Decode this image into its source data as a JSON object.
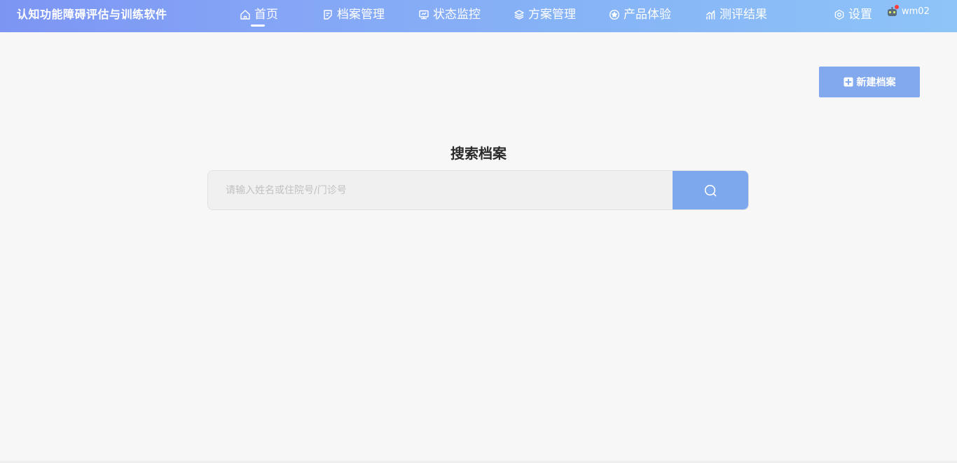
{
  "app": {
    "title": "认知功能障碍评估与训练软件"
  },
  "nav": {
    "items": [
      {
        "label": "首页",
        "icon": "home-icon",
        "active": true
      },
      {
        "label": "档案管理",
        "icon": "document-icon"
      },
      {
        "label": "状态监控",
        "icon": "monitor-icon"
      },
      {
        "label": "方案管理",
        "icon": "layers-icon"
      },
      {
        "label": "产品体验",
        "icon": "star-icon"
      },
      {
        "label": "测评结果",
        "icon": "chart-icon"
      }
    ],
    "settings": {
      "label": "设置",
      "icon": "settings-icon"
    }
  },
  "user": {
    "name": "wm02",
    "icon": "robot-avatar-icon"
  },
  "actions": {
    "new_record_label": "新建档案",
    "icon": "plus-square-icon"
  },
  "search": {
    "title": "搜索档案",
    "placeholder": "请输入姓名或住院号/门诊号",
    "value": "",
    "button_icon": "search-icon"
  },
  "colors": {
    "header_gradient_start": "#7c95f3",
    "header_gradient_end": "#8ec4f8",
    "primary_button": "#82a9ee",
    "search_button": "#7ea8ed",
    "background": "#f7f7f7"
  }
}
